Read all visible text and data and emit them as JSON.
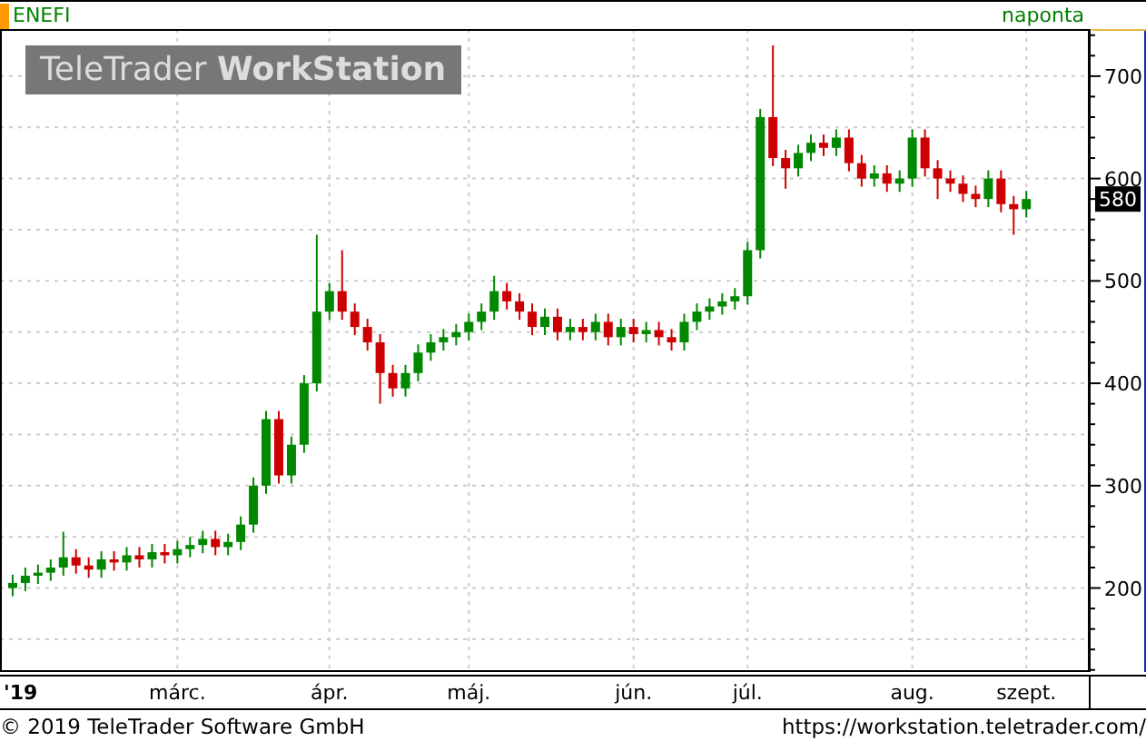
{
  "header": {
    "symbol": "ENEFI",
    "interval": "naponta"
  },
  "logo": {
    "text": "TeleTrader **WorkStation**"
  },
  "last_price_label": "580",
  "chart_data": {
    "type": "candlestick",
    "grid": true,
    "ylim": [
      118,
      746
    ],
    "yticks": [
      200,
      300,
      400,
      500,
      600,
      700
    ],
    "categories": [
      "'19",
      null,
      null,
      null,
      null,
      null,
      null,
      null,
      null,
      null,
      null,
      null,
      null,
      "márc.",
      null,
      null,
      null,
      null,
      null,
      null,
      null,
      null,
      null,
      null,
      null,
      "ápr.",
      null,
      null,
      null,
      null,
      null,
      null,
      null,
      null,
      null,
      null,
      "máj.",
      null,
      null,
      null,
      null,
      null,
      null,
      null,
      null,
      null,
      null,
      null,
      null,
      "jún.",
      null,
      null,
      null,
      null,
      null,
      null,
      null,
      null,
      "júl.",
      null,
      null,
      null,
      null,
      null,
      null,
      null,
      null,
      null,
      null,
      null,
      null,
      "aug.",
      null,
      null,
      null,
      null,
      null,
      null,
      null,
      null,
      "szept."
    ],
    "ohlc": [
      [
        200,
        213,
        192,
        205
      ],
      [
        205,
        220,
        197,
        212
      ],
      [
        212,
        223,
        204,
        215
      ],
      [
        215,
        228,
        207,
        220
      ],
      [
        220,
        255,
        212,
        230
      ],
      [
        230,
        238,
        214,
        222
      ],
      [
        222,
        230,
        210,
        218
      ],
      [
        218,
        236,
        210,
        228
      ],
      [
        228,
        236,
        217,
        225
      ],
      [
        225,
        240,
        217,
        232
      ],
      [
        232,
        240,
        220,
        228
      ],
      [
        228,
        243,
        220,
        235
      ],
      [
        235,
        243,
        224,
        232
      ],
      [
        232,
        246,
        224,
        238
      ],
      [
        238,
        250,
        230,
        242
      ],
      [
        242,
        256,
        234,
        248
      ],
      [
        248,
        256,
        232,
        240
      ],
      [
        240,
        253,
        232,
        245
      ],
      [
        245,
        270,
        237,
        262
      ],
      [
        262,
        308,
        254,
        300
      ],
      [
        300,
        373,
        292,
        365
      ],
      [
        365,
        373,
        302,
        310
      ],
      [
        310,
        348,
        302,
        340
      ],
      [
        340,
        408,
        332,
        400
      ],
      [
        400,
        545,
        392,
        470
      ],
      [
        470,
        498,
        462,
        490
      ],
      [
        490,
        530,
        462,
        470
      ],
      [
        470,
        478,
        447,
        455
      ],
      [
        455,
        463,
        432,
        440
      ],
      [
        440,
        448,
        380,
        410
      ],
      [
        410,
        418,
        387,
        395
      ],
      [
        395,
        418,
        387,
        410
      ],
      [
        410,
        438,
        402,
        430
      ],
      [
        430,
        448,
        422,
        440
      ],
      [
        440,
        453,
        432,
        445
      ],
      [
        445,
        458,
        437,
        450
      ],
      [
        450,
        468,
        442,
        460
      ],
      [
        460,
        478,
        452,
        470
      ],
      [
        470,
        505,
        462,
        490
      ],
      [
        490,
        498,
        472,
        480
      ],
      [
        480,
        488,
        462,
        470
      ],
      [
        470,
        478,
        447,
        455
      ],
      [
        455,
        473,
        447,
        465
      ],
      [
        465,
        473,
        442,
        450
      ],
      [
        450,
        463,
        442,
        455
      ],
      [
        455,
        463,
        442,
        450
      ],
      [
        450,
        468,
        442,
        460
      ],
      [
        460,
        468,
        437,
        445
      ],
      [
        445,
        463,
        437,
        455
      ],
      [
        455,
        463,
        440,
        448
      ],
      [
        448,
        460,
        440,
        452
      ],
      [
        452,
        460,
        437,
        445
      ],
      [
        445,
        453,
        432,
        440
      ],
      [
        440,
        468,
        432,
        460
      ],
      [
        460,
        478,
        452,
        470
      ],
      [
        470,
        483,
        462,
        475
      ],
      [
        475,
        488,
        467,
        480
      ],
      [
        480,
        493,
        472,
        485
      ],
      [
        485,
        538,
        477,
        530
      ],
      [
        530,
        668,
        522,
        660
      ],
      [
        660,
        730,
        612,
        620
      ],
      [
        620,
        628,
        590,
        610
      ],
      [
        610,
        633,
        602,
        625
      ],
      [
        625,
        643,
        617,
        635
      ],
      [
        635,
        643,
        622,
        630
      ],
      [
        630,
        648,
        622,
        640
      ],
      [
        640,
        648,
        607,
        615
      ],
      [
        615,
        623,
        592,
        600
      ],
      [
        600,
        613,
        592,
        605
      ],
      [
        605,
        613,
        587,
        595
      ],
      [
        595,
        608,
        587,
        600
      ],
      [
        600,
        648,
        592,
        640
      ],
      [
        640,
        648,
        602,
        610
      ],
      [
        610,
        618,
        580,
        600
      ],
      [
        600,
        608,
        587,
        595
      ],
      [
        595,
        603,
        577,
        585
      ],
      [
        585,
        593,
        572,
        580
      ],
      [
        580,
        608,
        572,
        600
      ],
      [
        600,
        608,
        567,
        575
      ],
      [
        575,
        583,
        545,
        570
      ],
      [
        570,
        588,
        562,
        580
      ]
    ]
  },
  "footer": {
    "copyright": "© 2019 TeleTrader Software GmbH",
    "url": "https://workstation.teletrader.com/"
  }
}
